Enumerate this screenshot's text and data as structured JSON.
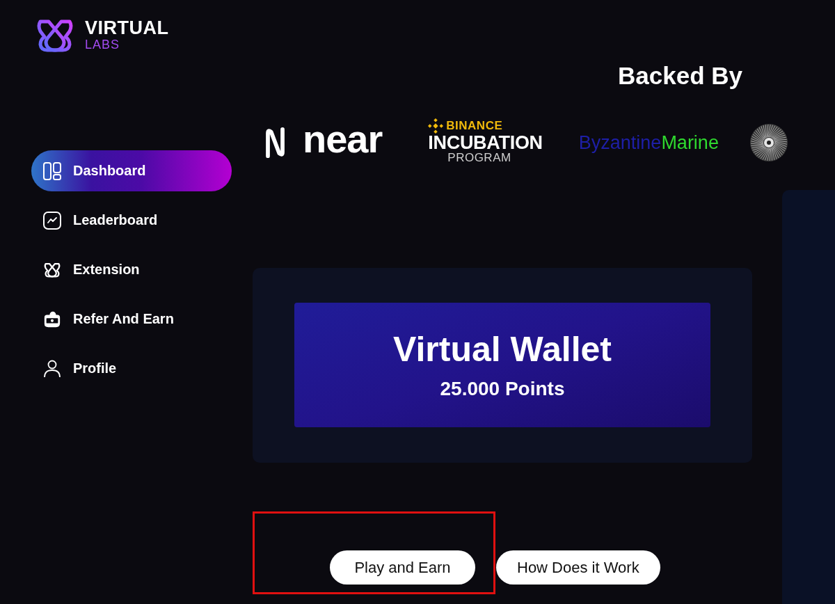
{
  "brand": {
    "name": "VIRTUAL",
    "sub": "LABS"
  },
  "sidebar": {
    "items": [
      {
        "kind": "dashboard",
        "label": "Dashboard",
        "selected": true
      },
      {
        "kind": "leaderboard",
        "label": "Leaderboard",
        "selected": false
      },
      {
        "kind": "extension",
        "label": "Extension",
        "selected": false
      },
      {
        "kind": "referral",
        "label": "Refer And Earn",
        "selected": false
      },
      {
        "kind": "profile",
        "label": "Profile",
        "selected": false
      }
    ]
  },
  "backers": {
    "title": "Backed By",
    "logos": [
      {
        "kind": "mark",
        "text": "near"
      },
      {
        "kind": "incubation",
        "lines": [
          "BINANCE",
          "INCUBATION",
          "PROGRAM"
        ]
      },
      {
        "kind": "split",
        "parts": [
          "Byzantine",
          "Marine"
        ]
      },
      {
        "kind": "emblem"
      }
    ]
  },
  "wallet": {
    "title": "Virtual Wallet",
    "points": "25.000 Points"
  },
  "actions": [
    {
      "label": "Play and Earn",
      "highlighted": true
    },
    {
      "label": "How Does it Work",
      "highlighted": false
    }
  ]
}
